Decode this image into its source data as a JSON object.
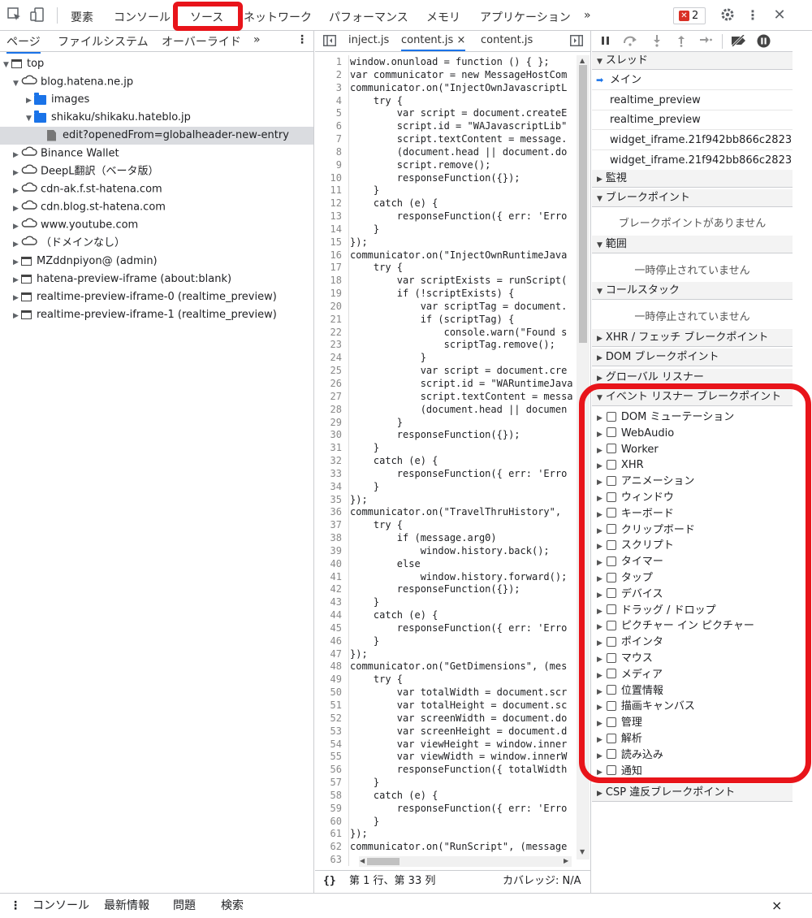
{
  "toolbar": {
    "tabs": [
      "要素",
      "コンソール",
      "ソース",
      "ネットワーク",
      "パフォーマンス",
      "メモリ",
      "アプリケーション"
    ],
    "more": "»",
    "error_count": "2"
  },
  "navigator": {
    "tabs": [
      "ページ",
      "ファイルシステム",
      "オーバーライド"
    ],
    "more": "»",
    "tree": [
      {
        "label": "top"
      },
      {
        "label": "blog.hatena.ne.jp"
      },
      {
        "label": "images"
      },
      {
        "label": "shikaku/shikaku.hateblo.jp"
      },
      {
        "label": "edit?openedFrom=globalheader-new-entry"
      },
      {
        "label": "Binance Wallet"
      },
      {
        "label": "DeepL翻訳（ベータ版）"
      },
      {
        "label": "cdn-ak.f.st-hatena.com"
      },
      {
        "label": "cdn.blog.st-hatena.com"
      },
      {
        "label": "www.youtube.com"
      },
      {
        "label": "（ドメインなし）"
      },
      {
        "label": "MZddnpiyon@ (admin)"
      },
      {
        "label": "hatena-preview-iframe (about:blank)"
      },
      {
        "label": "realtime-preview-iframe-0 (realtime_preview)"
      },
      {
        "label": "realtime-preview-iframe-1 (realtime_preview)"
      }
    ]
  },
  "editor": {
    "tabs": [
      "inject.js",
      "content.js",
      "content.js"
    ],
    "close": "×",
    "lines": [
      "window.onunload = function () { };",
      "var communicator = new MessageHostCom",
      "communicator.on(\"InjectOwnJavascriptL",
      "    try {",
      "        var script = document.createE",
      "        script.id = \"WAJavascriptLib\"",
      "        script.textContent = message.",
      "        (document.head || document.do",
      "        script.remove();",
      "        responseFunction({});",
      "    }",
      "    catch (e) {",
      "        responseFunction({ err: 'Erro",
      "    }",
      "});",
      "communicator.on(\"InjectOwnRuntimeJava",
      "    try {",
      "        var scriptExists = runScript(",
      "        if (!scriptExists) {",
      "            var scriptTag = document.",
      "            if (scriptTag) {",
      "                console.warn(\"Found s",
      "                scriptTag.remove();",
      "            }",
      "            var script = document.cre",
      "            script.id = \"WARuntimeJava",
      "            script.textContent = messa",
      "            (document.head || documen",
      "        }",
      "        responseFunction({});",
      "    }",
      "    catch (e) {",
      "        responseFunction({ err: 'Erro",
      "    }",
      "});",
      "communicator.on(\"TravelThruHistory\",",
      "    try {",
      "        if (message.arg0)",
      "            window.history.back();",
      "        else",
      "            window.history.forward();",
      "        responseFunction({});",
      "    }",
      "    catch (e) {",
      "        responseFunction({ err: 'Erro",
      "    }",
      "});",
      "communicator.on(\"GetDimensions\", (mes",
      "    try {",
      "        var totalWidth = document.scr",
      "        var totalHeight = document.sc",
      "        var screenWidth = document.do",
      "        var screenHeight = document.d",
      "        var viewHeight = window.inner",
      "        var viewWidth = window.innerW",
      "        responseFunction({ totalWidth",
      "    }",
      "    catch (e) {",
      "        responseFunction({ err: 'Erro",
      "    }",
      "});",
      "communicator.on(\"RunScript\", (message",
      ""
    ],
    "status_braces": "{}",
    "status_position": "第 1 行、第 33 列",
    "status_coverage": "カバレッジ: N/A"
  },
  "debugger": {
    "threads_title": "スレッド",
    "threads": [
      "メイン",
      "realtime_preview",
      "realtime_preview",
      "widget_iframe.21f942bb866c28233...",
      "widget_iframe.21f942bb866c28233..."
    ],
    "watch": "監視",
    "breakpoints": "ブレークポイント",
    "no_breakpoints": "ブレークポイントがありません",
    "scope": "範囲",
    "not_paused_1": "一時停止されていません",
    "callstack": "コールスタック",
    "not_paused_2": "一時停止されていません",
    "xhr": "XHR / フェッチ ブレークポイント",
    "dom": "DOM ブレークポイント",
    "global": "グローバル リスナー",
    "event_listeners": "イベント リスナー ブレークポイント",
    "events": [
      "DOM ミューテーション",
      "WebAudio",
      "Worker",
      "XHR",
      "アニメーション",
      "ウィンドウ",
      "キーボード",
      "クリップボード",
      "スクリプト",
      "タイマー",
      "タップ",
      "デバイス",
      "ドラッグ / ドロップ",
      "ピクチャー イン ピクチャー",
      "ポインタ",
      "マウス",
      "メディア",
      "位置情報",
      "描画キャンバス",
      "管理",
      "解析",
      "読み込み",
      "通知"
    ],
    "csp": "CSP 違反ブレークポイント"
  },
  "drawer": {
    "tabs": [
      "コンソール",
      "最新情報",
      "問題",
      "検索"
    ],
    "close": "×"
  },
  "colors": {
    "highlight": "#e8141a",
    "accent": "#1a73e8"
  }
}
